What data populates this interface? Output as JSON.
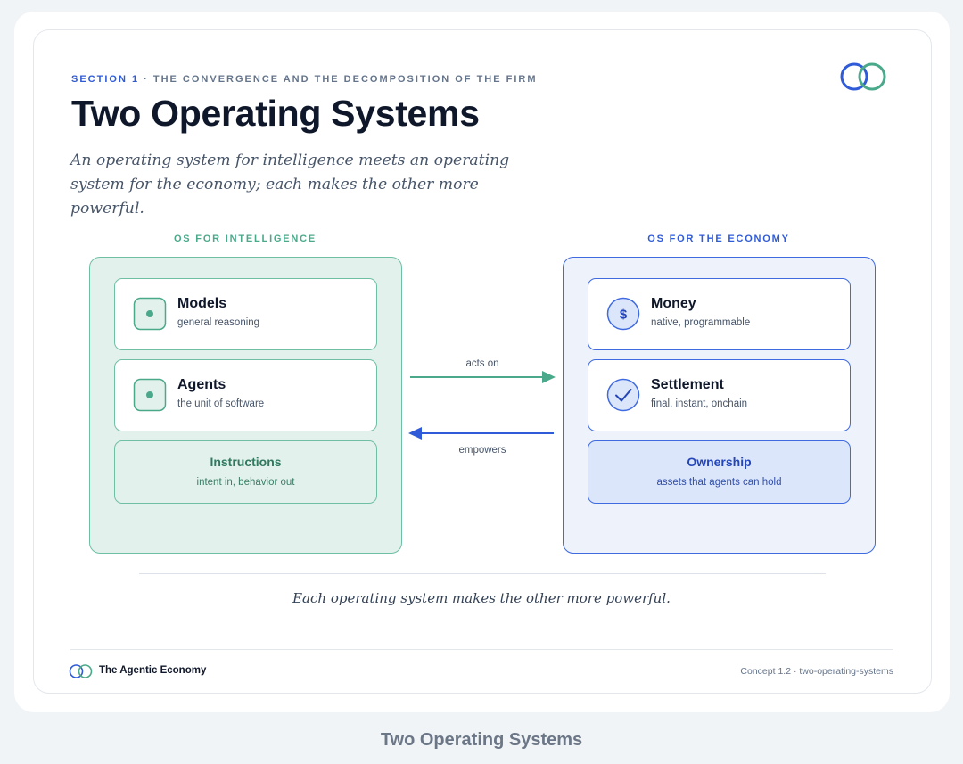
{
  "header": {
    "section_label": "SECTION 1",
    "separator": " · ",
    "section_topic": "THE CONVERGENCE AND THE DECOMPOSITION OF THE FIRM",
    "title": "Two Operating Systems",
    "subtitle": "An operating system for intelligence meets an operating system for the economy; each makes the other more powerful."
  },
  "colors": {
    "teal": "#4ba98b",
    "blue": "#2f5bd8",
    "teal_fill": "#e3f1ec",
    "blue_fill": "#eef3fb"
  },
  "left_panel": {
    "label": "OS FOR INTELLIGENCE",
    "items": [
      {
        "title": "Models",
        "desc": "general reasoning",
        "icon": "dot-square-icon"
      },
      {
        "title": "Agents",
        "desc": "the unit of software",
        "icon": "dot-square-icon"
      }
    ],
    "foundation": {
      "title": "Instructions",
      "desc": "intent in, behavior out"
    }
  },
  "right_panel": {
    "label": "OS FOR THE ECONOMY",
    "items": [
      {
        "title": "Money",
        "desc": "native, programmable",
        "icon": "dollar-circle-icon",
        "glyph": "$"
      },
      {
        "title": "Settlement",
        "desc": "final, instant, onchain",
        "icon": "check-circle-icon"
      }
    ],
    "foundation": {
      "title": "Ownership",
      "desc": "assets that agents can hold"
    }
  },
  "arrows": {
    "forward_label": "acts on",
    "backward_label": "empowers"
  },
  "caption": "Each operating system makes the other more powerful.",
  "footer": {
    "brand": "The Agentic Economy",
    "concept": "Concept 1.2 · two-operating-systems"
  },
  "page_caption": "Two Operating Systems"
}
